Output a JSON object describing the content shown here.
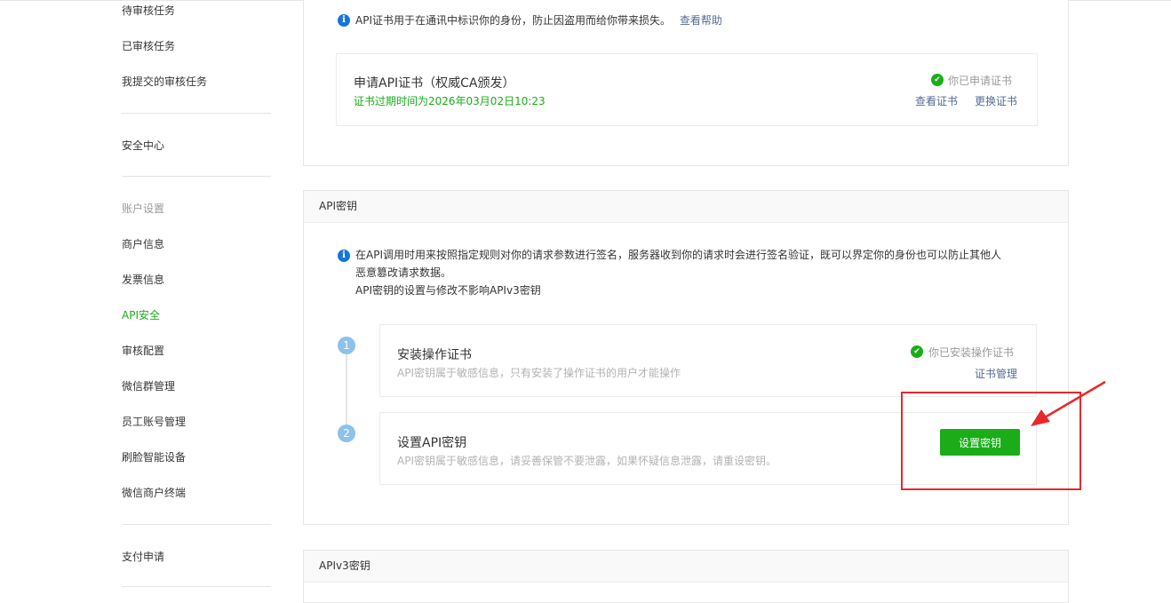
{
  "sidebar": {
    "items": [
      {
        "label": "待审核任务"
      },
      {
        "label": "已审核任务"
      },
      {
        "label": "我提交的审核任务"
      },
      {
        "label": "安全中心"
      },
      {
        "label": "账户设置"
      },
      {
        "label": "商户信息"
      },
      {
        "label": "发票信息"
      },
      {
        "label": "API安全"
      },
      {
        "label": "审核配置"
      },
      {
        "label": "微信群管理"
      },
      {
        "label": "员工账号管理"
      },
      {
        "label": "刷脸智能设备"
      },
      {
        "label": "微信商户终端"
      },
      {
        "label": "支付申请"
      }
    ]
  },
  "cert_section": {
    "info_text": "API证书用于在通讯中标识你的身份，防止因盗用而给你带来损失。",
    "help_link": "查看帮助",
    "card_title": "申请API证书（权威CA颁发）",
    "expiry": "证书过期时间为2026年03月02日10:23",
    "status": "你已申请证书",
    "view_link": "查看证书",
    "replace_link": "更换证书"
  },
  "api_key_section": {
    "title": "API密钥",
    "info_line1": "在API调用时用来按照指定规则对你的请求参数进行签名，服务器收到你的请求时会进行签名验证，既可以界定你的身份也可以防止其他人",
    "info_line2": "恶意篡改请求数据。",
    "info_line3": "API密钥的设置与修改不影响APIv3密钥",
    "step1": {
      "num": "1",
      "title": "安装操作证书",
      "desc": "API密钥属于敏感信息，只有安装了操作证书的用户才能操作",
      "status": "你已安装操作证书",
      "link": "证书管理"
    },
    "step2": {
      "num": "2",
      "title": "设置API密钥",
      "desc": "API密钥属于敏感信息，请妥善保管不要泄露，如果怀疑信息泄露，请重设密钥。",
      "button": "设置密钥"
    }
  },
  "apiv3_section": {
    "title": "APIv3密钥"
  },
  "icons": {
    "info": "info-icon",
    "check": "check-circle-icon",
    "arrow": "red-arrow-annotation"
  },
  "colors": {
    "accent_green": "#1aad19",
    "link_blue": "#576b95",
    "info_blue": "#1677d6",
    "annotation_red": "#e8292c"
  }
}
